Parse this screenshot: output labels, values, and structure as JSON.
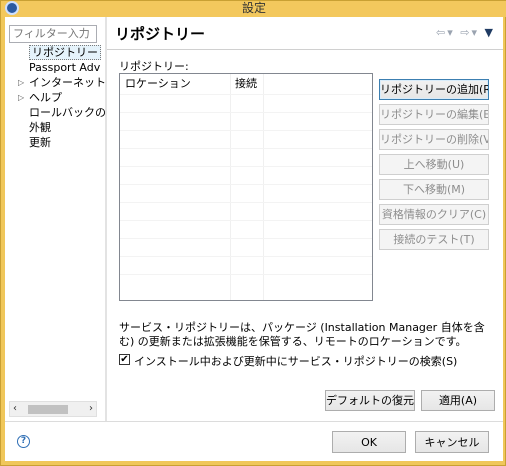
{
  "window": {
    "title": "設定"
  },
  "nav": {
    "filter_placeholder": "フィルター入力",
    "items": [
      {
        "label": "リポジトリー",
        "expandable": false,
        "selected": true
      },
      {
        "label": "Passport Adv",
        "expandable": false,
        "selected": false
      },
      {
        "label": "インターネット",
        "expandable": true,
        "selected": false
      },
      {
        "label": "ヘルプ",
        "expandable": true,
        "selected": false
      },
      {
        "label": "ロールバックのフ",
        "expandable": false,
        "selected": false
      },
      {
        "label": "外観",
        "expandable": false,
        "selected": false
      },
      {
        "label": "更新",
        "expandable": false,
        "selected": false
      }
    ]
  },
  "page": {
    "title": "リポジトリー",
    "section_label": "リポジトリー:",
    "table": {
      "columns": [
        "ロケーション",
        "接続"
      ],
      "rows": []
    },
    "buttons": {
      "add": "リポジトリーの追加(R)...",
      "edit": "リポジトリーの編集(E)...",
      "delete": "リポジトリーの削除(V)",
      "move_up": "上へ移動(U)",
      "move_down": "下へ移動(M)",
      "clear_credentials": "資格情報のクリア(C)",
      "test_connection": "接続のテスト(T)"
    },
    "description": "サービス・リポジトリーは、パッケージ (Installation Manager 自体を含む) の更新または拡張機能を保管する、リモートのロケーションです。",
    "checkbox": {
      "label": "インストール中および更新中にサービス・リポジトリーの検索(S)",
      "checked": true
    },
    "restore_defaults": "デフォルトの復元(D)",
    "apply": "適用(A)"
  },
  "dialog": {
    "ok": "OK",
    "cancel": "キャンセル"
  },
  "icons": {
    "app": "app-icon",
    "back": "back-arrow-icon",
    "forward": "forward-arrow-icon",
    "menu": "view-menu-icon",
    "help": "help-icon",
    "check": "✔"
  }
}
